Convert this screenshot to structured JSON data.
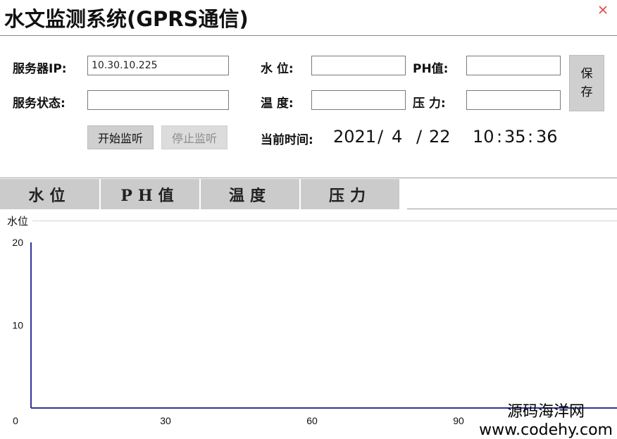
{
  "window": {
    "title": "水文监测系统(GPRS通信)",
    "close_icon": "close-icon",
    "close_color": "#e04646"
  },
  "form": {
    "server_ip_label": "服务器IP:",
    "server_ip_value": "10.30.10.225",
    "service_status_label": "服务状态:",
    "service_status_value": "",
    "water_level_label": "水 位:",
    "water_level_value": "",
    "ph_label": "PH值:",
    "ph_value": "",
    "temperature_label": "温 度:",
    "temperature_value": "",
    "pressure_label": "压 力:",
    "pressure_value": "",
    "save_label_1": "保",
    "save_label_2": "存",
    "start_button": "开始监听",
    "stop_button": "停止监听",
    "current_time_label": "当前时间:",
    "date_year": "2021",
    "date_sep": "/",
    "date_month": "4",
    "date_day": "22",
    "time_h": "10",
    "time_sep": ":",
    "time_m": "35",
    "time_s": "36"
  },
  "tabs": [
    {
      "label": "水位"
    },
    {
      "label": "PH值"
    },
    {
      "label": "温度"
    },
    {
      "label": "压力"
    }
  ],
  "chart_data": {
    "type": "line",
    "title": "水位",
    "xlabel": "",
    "ylabel": "",
    "x_ticks": [
      0,
      30,
      60,
      90
    ],
    "y_ticks": [
      20,
      10
    ],
    "xlim": [
      0,
      120
    ],
    "ylim": [
      0,
      20
    ],
    "series": [],
    "axis_color": "#333399",
    "grid": false
  },
  "watermark": {
    "cn": "源码海洋网",
    "url": "www.codehy.com"
  }
}
